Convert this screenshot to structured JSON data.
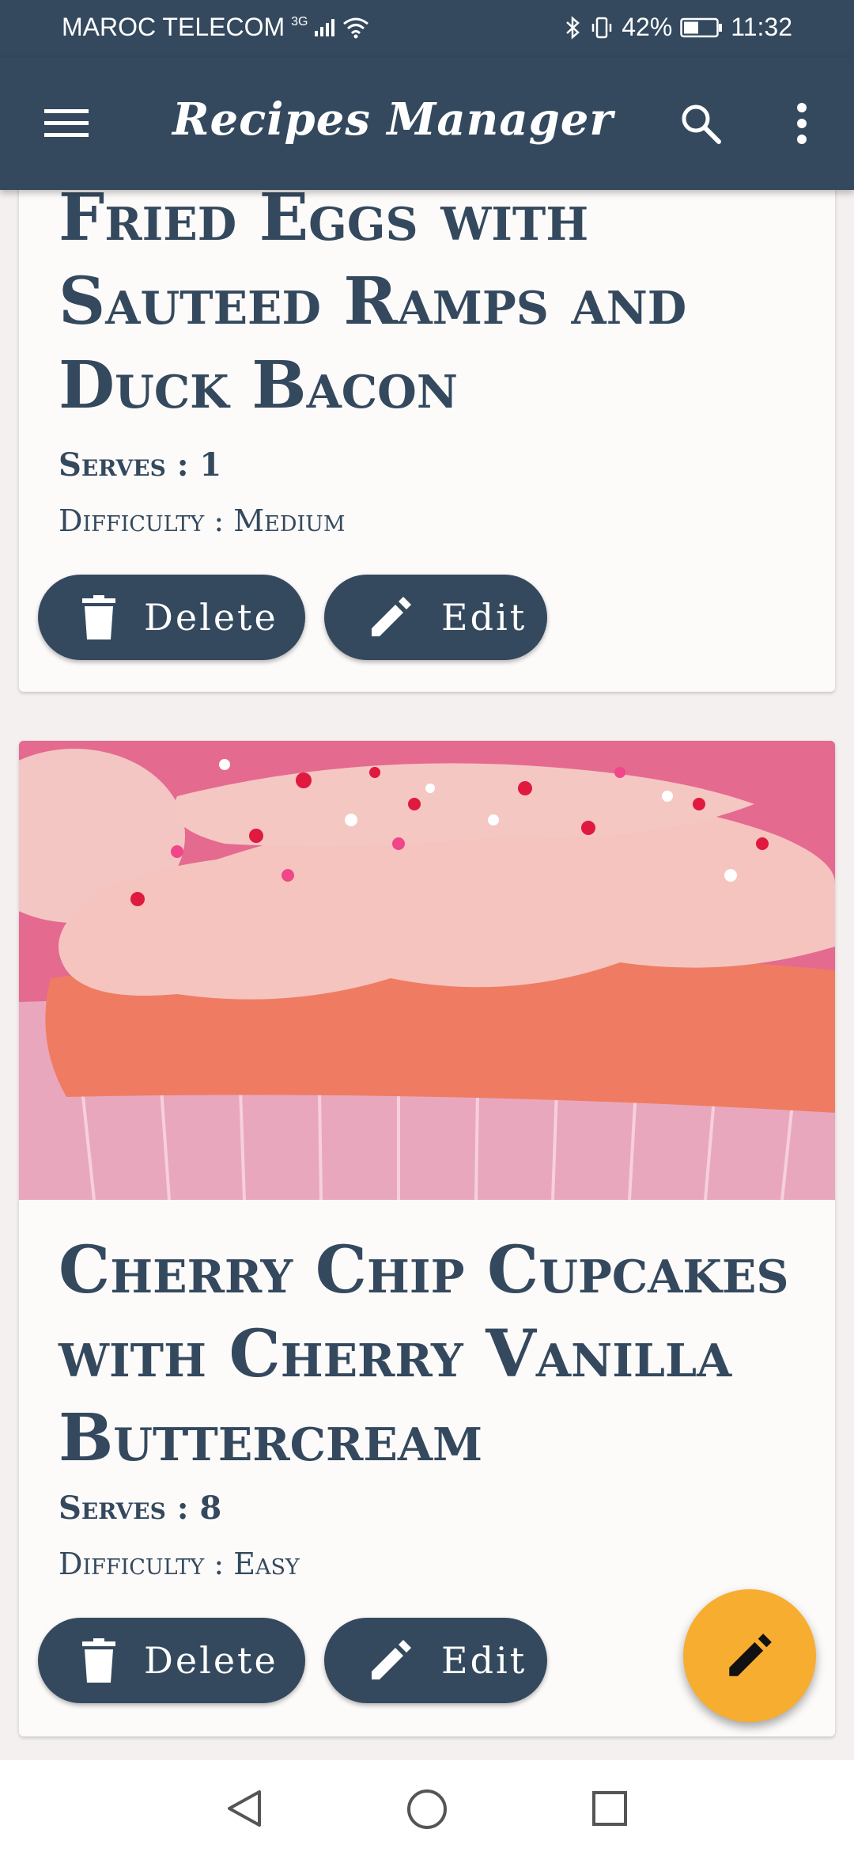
{
  "status_bar": {
    "carrier": "MAROC TELECOM",
    "network": "3G",
    "battery": "42%",
    "time": "11:32"
  },
  "app_bar": {
    "title": "Recipes Manager",
    "menu_icon": "menu-icon",
    "search_icon": "search-icon",
    "more_icon": "more-vert-icon",
    "color": "#34495e"
  },
  "recipes": [
    {
      "title": "Fried Eggs with Sauteed Ramps and Duck Bacon",
      "serves": "Serves : 1",
      "difficulty": "Difficulty : Medium",
      "delete_label": "Delete",
      "edit_label": "Edit"
    },
    {
      "title": "Cherry Chip Cupcakes with Cherry Vanilla Buttercream",
      "serves": "Serves : 8",
      "difficulty": "Difficulty : Easy",
      "delete_label": "Delete",
      "edit_label": "Edit"
    }
  ],
  "fab": {
    "icon": "pencil-icon",
    "color": "#f7ad2f"
  },
  "nav_bar": {
    "back": "back-icon",
    "home": "home-icon",
    "recents": "recents-icon"
  }
}
